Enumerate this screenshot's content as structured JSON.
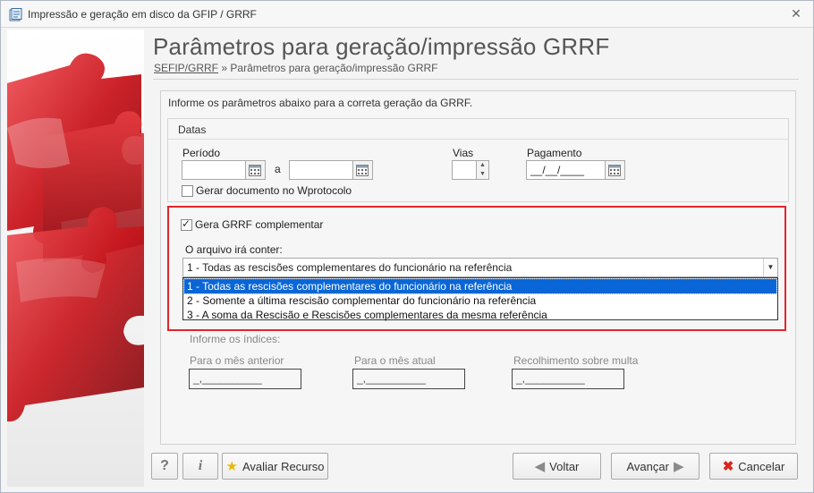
{
  "window": {
    "title": "Impressão e geração em disco da GFIP / GRRF"
  },
  "header": {
    "title": "Parâmetros para geração/impressão GRRF",
    "breadcrumb_link": "SEFIP/GRRF",
    "breadcrumb_separator": "»",
    "breadcrumb_current": "Parâmetros para geração/impressão GRRF"
  },
  "form": {
    "info": "Informe os parâmetros abaixo para a correta geração da GRRF.",
    "datas_legend": "Datas",
    "periodo_label": "Período",
    "periodo_start": "",
    "periodo_sep": "a",
    "periodo_end": "",
    "vias_label": "Vias",
    "vias_value": "",
    "pagamento_label": "Pagamento",
    "pagamento_value": "__/__/____",
    "wprotocolo_label": "Gerar documento no Wprotocolo",
    "wprotocolo_checked": false,
    "complementar_label": "Gera GRRF complementar",
    "complementar_checked": true,
    "arquivo_label": "O arquivo irá conter:",
    "arquivo_selected": "1 - Todas as rescisões complementares do funcionário na referência",
    "arquivo_options": [
      "1 - Todas as rescisões complementares do funcionário na referência",
      "2 - Somente a última rescisão complementar do funcionário na referência",
      "3 - A soma da Rescisão e Rescisões complementares da mesma referência"
    ],
    "indices_label": "Informe os índices:",
    "mes_anterior_label": "Para o mês anterior",
    "mes_anterior_value": "_,__________",
    "mes_atual_label": "Para o mês atual",
    "mes_atual_value": "_,__________",
    "multa_label": "Recolhimento sobre multa",
    "multa_value": "_,__________"
  },
  "footer": {
    "help_label": "?",
    "info_label": "i",
    "avaliar_label": "Avaliar Recurso",
    "voltar_label": "Voltar",
    "avancar_label": "Avançar",
    "cancelar_label": "Cancelar"
  },
  "colors": {
    "highlight_border": "#e0262b",
    "selection": "#0a66d6",
    "puzzle_red": "#c8161d"
  }
}
